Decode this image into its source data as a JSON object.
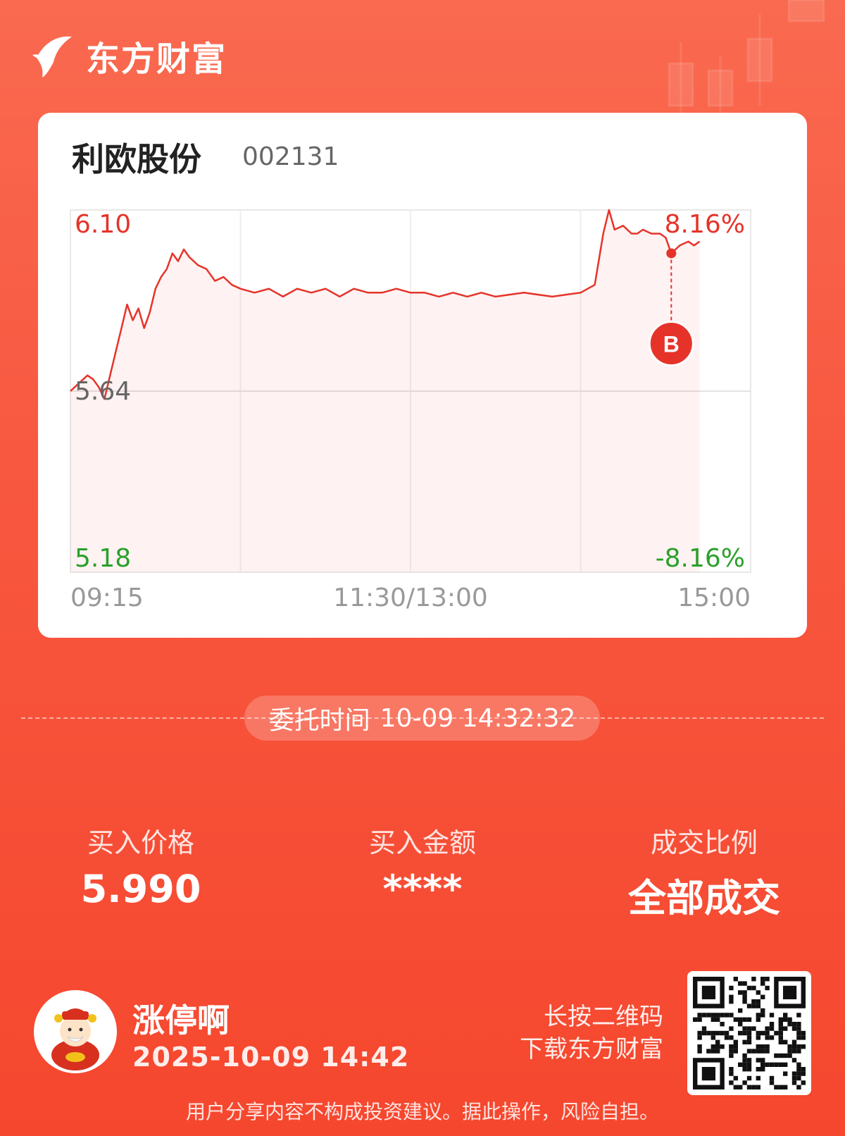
{
  "header": {
    "brand_name": "东方财富",
    "logo_icon": "eastmoney-logo-icon"
  },
  "stock": {
    "name": "利欧股份",
    "code": "002131"
  },
  "chart_data": {
    "type": "line",
    "title": "",
    "x_ticks": [
      "09:15",
      "11:30/13:00",
      "15:00"
    ],
    "y_left_ticks": [
      "6.10",
      "5.64",
      "5.18"
    ],
    "y_right_ticks": [
      "8.16%",
      "-8.16%"
    ],
    "ylim": [
      5.18,
      6.1
    ],
    "prev_close": 5.64,
    "colors": {
      "line": "#e6332a",
      "up": "#e6332a",
      "down": "#2aa02a",
      "mid": "#666666"
    },
    "marker": {
      "label": "B",
      "time": "14:32",
      "price": 5.99
    },
    "x": [
      "09:30",
      "09:33",
      "09:36",
      "09:38",
      "09:40",
      "09:42",
      "09:44",
      "09:46",
      "09:48",
      "09:50",
      "09:52",
      "09:54",
      "09:56",
      "09:58",
      "10:00",
      "10:02",
      "10:04",
      "10:06",
      "10:08",
      "10:10",
      "10:12",
      "10:15",
      "10:18",
      "10:21",
      "10:24",
      "10:27",
      "10:30",
      "10:35",
      "10:40",
      "10:45",
      "10:50",
      "10:55",
      "11:00",
      "11:05",
      "11:10",
      "11:15",
      "11:20",
      "11:25",
      "11:30",
      "13:05",
      "13:10",
      "13:15",
      "13:20",
      "13:25",
      "13:30",
      "13:40",
      "13:50",
      "14:00",
      "14:05",
      "14:08",
      "14:10",
      "14:12",
      "14:15",
      "14:18",
      "14:20",
      "14:22",
      "14:25",
      "14:28",
      "14:30",
      "14:32",
      "14:35",
      "14:38",
      "14:40",
      "14:42"
    ],
    "values": [
      5.64,
      5.66,
      5.68,
      5.67,
      5.65,
      5.62,
      5.68,
      5.74,
      5.8,
      5.86,
      5.82,
      5.85,
      5.8,
      5.84,
      5.9,
      5.93,
      5.95,
      5.99,
      5.97,
      6.0,
      5.98,
      5.96,
      5.95,
      5.92,
      5.93,
      5.91,
      5.9,
      5.89,
      5.9,
      5.88,
      5.9,
      5.89,
      5.9,
      5.88,
      5.9,
      5.89,
      5.89,
      5.9,
      5.89,
      5.89,
      5.88,
      5.89,
      5.88,
      5.89,
      5.88,
      5.89,
      5.88,
      5.89,
      5.91,
      6.04,
      6.1,
      6.05,
      6.06,
      6.04,
      6.04,
      6.05,
      6.04,
      6.04,
      6.03,
      5.99,
      6.01,
      6.02,
      6.01,
      6.02
    ]
  },
  "order": {
    "label": "委托时间",
    "time": "10-09 14:32:32"
  },
  "stats": [
    {
      "label": "买入价格",
      "value": "5.990"
    },
    {
      "label": "买入金额",
      "value": "****"
    },
    {
      "label": "成交比例",
      "value": "全部成交"
    }
  ],
  "user": {
    "name": "涨停啊",
    "time": "2025-10-09 14:42",
    "avatar_icon": "caishen-avatar-icon"
  },
  "qr": {
    "hint_line1": "长按二维码",
    "hint_line2": "下载东方财富",
    "icon": "qr-code-icon"
  },
  "disclaimer": "用户分享内容不构成投资建议。据此操作，风险自担。"
}
